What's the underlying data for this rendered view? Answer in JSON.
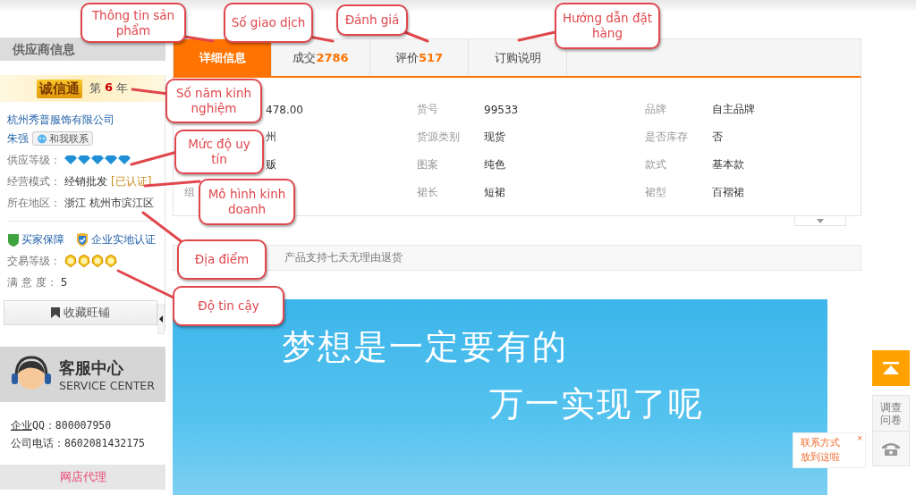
{
  "callouts": [
    "Thông tin sản phẩm",
    "Số giao dịch",
    "Đánh giá",
    "Hướng dẫn đặt hàng",
    "Số năm kinh nghiệm",
    "Mức độ uy tín",
    "Mô hình kinh doanh",
    "Địa điểm",
    "Độ tin cậy"
  ],
  "sidebar": {
    "title": "供应商信息",
    "membership": {
      "logo": "诚信通",
      "prefix": "第",
      "years": "6",
      "suffix": "年"
    },
    "company": "杭州秀普服饰有限公司",
    "contact": {
      "name": "朱强",
      "button": "和我联系"
    },
    "fields": [
      {
        "kind": "diamonds",
        "label": "供应等级：",
        "stars": 5
      },
      {
        "kind": "text",
        "label": "经营模式：",
        "value": "经销批发",
        "badge": "[已认证]"
      },
      {
        "kind": "text",
        "label": "所在地区：",
        "value": "浙江 杭州市滨江区"
      }
    ],
    "guarantees": [
      "买家保障",
      "企业实地认证"
    ],
    "trade_fields": [
      {
        "kind": "medals",
        "label": "交易等级：",
        "stars": 4
      },
      {
        "kind": "text",
        "label": "满 意 度：",
        "value": "5"
      }
    ],
    "favorite_button": "收藏旺铺",
    "service": {
      "title": "客服中心",
      "subtitle": "SERVICE CENTER",
      "lines": [
        {
          "link": "企业",
          "label": "QQ：",
          "value": "800007950"
        },
        {
          "label": "公司电话：",
          "value": "8602081432175"
        }
      ]
    },
    "agent_link": "网店代理"
  },
  "tabs": [
    {
      "label": "详细信息",
      "selected": true
    },
    {
      "label": "成交",
      "count": "2786",
      "selected": false
    },
    {
      "label": "评价",
      "count": "517",
      "selected": false
    },
    {
      "label": "订购说明",
      "selected": false
    }
  ],
  "details": [
    {
      "column_2": "478.00",
      "label_2": "货号",
      "value_2": "99533",
      "label_3": "品牌",
      "value_3": "自主品牌"
    },
    {
      "column_2": "州",
      "label_2": "货源类别",
      "value_2": "现货",
      "label_3": "是否库存",
      "value_3": "否"
    },
    {
      "column_2": "贩",
      "label_2": "图案",
      "value_2": "纯色",
      "label_3": "款式",
      "value_3": "基本款"
    },
    {
      "column_1": "组",
      "label_2": "裙长",
      "value_2": "短裙",
      "label_3": "裙型",
      "value_3": "百褶裙"
    }
  ],
  "notice": "产品支持七天无理由退货",
  "banner": {
    "lines": [
      "梦想是一定要有的",
      "万一实现了呢"
    ]
  },
  "side_tools": {
    "survey": "调查问卷",
    "popup": {
      "text": "联系方式放到这啦",
      "close": "×"
    }
  }
}
